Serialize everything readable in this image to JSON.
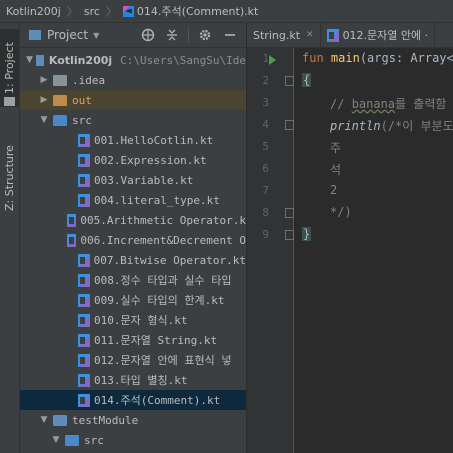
{
  "breadcrumb": {
    "items": [
      "Kotlin200j",
      "src",
      "014.주석(Comment).kt"
    ],
    "separator": "〉"
  },
  "stripe": {
    "project_tab": "1: Project",
    "structure_tab": "Z: Structure"
  },
  "project_panel": {
    "title": "Project",
    "dropdown_glyph": "▼",
    "icons": [
      "globe-icon",
      "collapse-icon",
      "gear-icon",
      "minimize-icon"
    ]
  },
  "tree": {
    "root": {
      "label": "Kotlin200j",
      "path": "C:\\Users\\SangSu\\Ide"
    },
    "idea": ".idea",
    "out": "out",
    "src": "src",
    "files": [
      "001.HelloCotlin.kt",
      "002.Expression.kt",
      "003.Variable.kt",
      "004.literal_type.kt",
      "005.Arithmetic Operator.k",
      "006.Increment&Decrement O",
      "007.Bitwise Operator.kt",
      "008.정수 타입과 실수 타입",
      "009.실수 타입의 한계.kt",
      "010.문자 형식.kt",
      "011.문자열 String.kt",
      "012.문자열 안에 표현식 넣",
      "013.타입 별칭.kt",
      "014.주석(Comment).kt"
    ],
    "test_module": "testModule",
    "test_src": "src"
  },
  "editor": {
    "tabs": [
      "String.kt",
      "012.문자열 안에 ·"
    ],
    "line_numbers": [
      "1",
      "2",
      "3",
      "4",
      "5",
      "6",
      "7",
      "8",
      "9"
    ],
    "code": {
      "l1_kw": "fun",
      "l1_fn": "main",
      "l1_rest": "(args: Array<S",
      "l2": "{",
      "l4_comment_a": "// ",
      "l4_comment_b": "banana",
      "l4_comment_c": "를 출력함",
      "l5_fn": "println",
      "l5_rest": "(/*이 부분도",
      "l6": "주",
      "l7": "석",
      "l8": "2",
      "l9": "*/)",
      "l10": "}"
    }
  },
  "colors": {
    "selection": "#0d293e",
    "keyword": "#cc7832",
    "function": "#ffc66d",
    "comment": "#808080",
    "run_arrow": "#499c54"
  }
}
